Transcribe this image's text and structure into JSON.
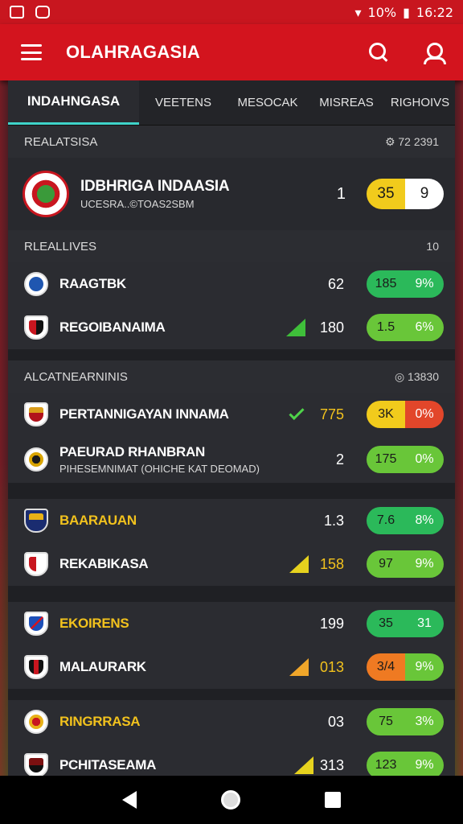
{
  "status_bar": {
    "battery": "10%",
    "time": "16:22"
  },
  "app_bar": {
    "title": "OLAHRAGASIA"
  },
  "tabs": [
    "INDAHNGASA",
    "VEETENS",
    "MESOCAK",
    "MISREAS",
    "RIGHOIVS"
  ],
  "sections": {
    "s1": {
      "title": "REALATSISA",
      "meta": "⚙ 72 2391"
    },
    "s2": {
      "title": "RLEALLIVES",
      "meta": "10"
    },
    "s3": {
      "title": "ALCATNEARNINIS",
      "meta": "◎ 13830"
    }
  },
  "featured": {
    "name": "IDBHRIGA INDAASIA",
    "sub": "UCESRA..©TOAS2SBM",
    "value": "1",
    "pill": [
      "35",
      "9"
    ]
  },
  "rows": {
    "r1": {
      "name": "RAAGTBK",
      "value": "62",
      "pill": [
        "185",
        "9%"
      ]
    },
    "r2": {
      "name": "REGOIBANAIMA",
      "value": "180",
      "pill": [
        "1.5",
        "6%"
      ]
    },
    "r3": {
      "name": "PERTANNIGAYAN INNAMA",
      "value": "775",
      "pill": [
        "3K",
        "0%"
      ]
    },
    "r4": {
      "name": "PAEURAD RHANBRAN",
      "sub": "PIHESEMNIMAT (OHICHE KAT DEOMAD)",
      "value": "2",
      "pill": [
        "175",
        "0%"
      ]
    },
    "r5": {
      "name": "BAARAUAN",
      "value": "1.3",
      "pill": [
        "7.6",
        "8%"
      ]
    },
    "r6": {
      "name": "REKABIKASA",
      "value": "158",
      "pill": [
        "97",
        "9%"
      ]
    },
    "r7": {
      "name": "EKOIRENS",
      "value": "199",
      "pill": [
        "35",
        "31"
      ]
    },
    "r8": {
      "name": "MALAURARK",
      "value": "013",
      "pill": [
        "3/4",
        "9%"
      ]
    },
    "r9": {
      "name": "RINGRRASA",
      "value": "03",
      "pill": [
        "75",
        "3%"
      ]
    },
    "r10": {
      "name": "PCHITASEAMA",
      "value": "313",
      "pill": [
        "123",
        "9%"
      ]
    }
  },
  "colors": {
    "brand_red": "#d3141e",
    "tab_indicator": "#3fd3c9",
    "green": "#2bb95a",
    "lime": "#69c639",
    "yellow": "#f1cb1c",
    "red": "#e2462a",
    "orange": "#ef7a22"
  },
  "icons": [
    "photo-icon",
    "messenger-icon",
    "menu-icon",
    "search-icon",
    "user-icon",
    "back-icon",
    "home-icon",
    "recents-icon"
  ]
}
